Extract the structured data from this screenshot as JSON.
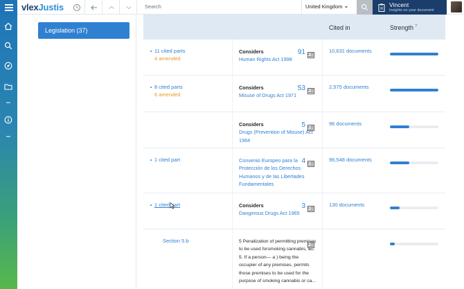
{
  "topbar": {
    "logo_text": "vlex",
    "logo_bold": "Justis",
    "search_placeholder": "Search",
    "country": "United Kingdom",
    "user_name": "Vincent",
    "user_sub": "Insights on your document"
  },
  "filters": {
    "legislation_label": "Legislation (37)"
  },
  "table": {
    "col_cited_in": "Cited in",
    "col_strength": "Strength",
    "strength_help": "?",
    "rows": [
      {
        "cited_parts": "11 cited parts",
        "amended": "4 amended",
        "relation": "Considers",
        "title": "Human Rights Act 1998",
        "count": "91",
        "cited_in": "10,631 documents",
        "strength": 1.0
      },
      {
        "cited_parts": "8 cited parts",
        "amended": "6 amended",
        "relation": "Considers",
        "title": "Misuse of Drugs Act 1971",
        "count": "53",
        "cited_in": "2,575 documents",
        "strength": 1.0
      },
      {
        "cited_parts": "",
        "amended": "",
        "relation": "Considers",
        "title": "Drugs (Prevention of Misuse) Act 1964",
        "count": "5",
        "cited_in": "96 documents",
        "strength": 0.4
      },
      {
        "cited_parts": "1 cited part",
        "amended": "",
        "relation": "",
        "title": "Convenio Europeo para la Protección de los Derechos Humanos y de las Libertades Fundamentales",
        "count": "4",
        "cited_in": "96,548 documents",
        "strength": 0.4
      },
      {
        "cited_parts": "1 cited part",
        "amended": "",
        "relation": "Considers",
        "title": "Dangerous Drugs Act 1965",
        "count": "3",
        "cited_in": "130 documents",
        "strength": 0.2
      }
    ],
    "section_row": {
      "section": "Section 5.b",
      "text": "5 Penalization of permitting premises to be used forsmoking cannabis, &c. 5. If a person— a ) being the occupier of any premises, permits those premises to be used for the purpose of smoking cannabis or ca...",
      "strength": 0.1
    }
  },
  "colors": {
    "accent": "#2f80d1",
    "amended": "#e59a2c",
    "navy": "#1a3d6b",
    "header_bg": "#dfe9f4"
  }
}
